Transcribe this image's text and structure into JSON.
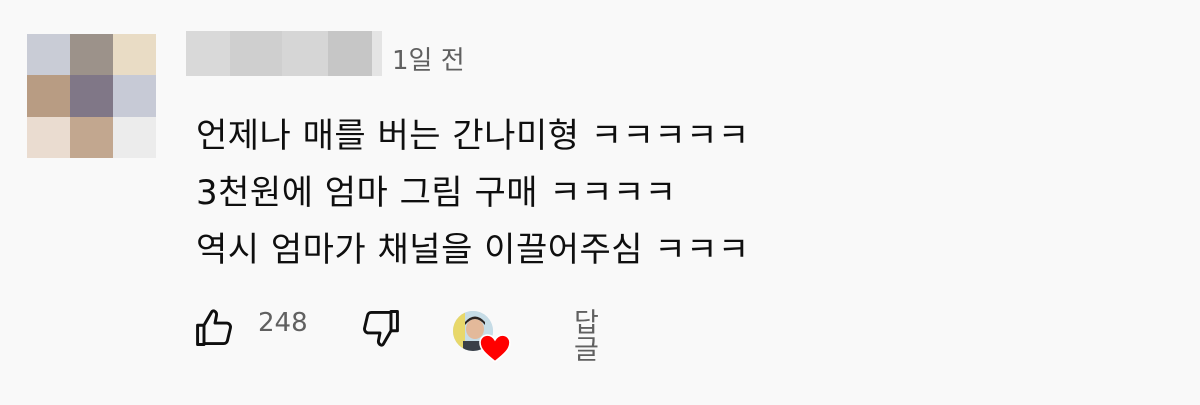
{
  "comment": {
    "timestamp": "1일 전",
    "lines": [
      "언제나 매를 버는 간나미형 ㅋㅋㅋㅋㅋ",
      "3천원에 엄마 그림 구매 ㅋㅋㅋㅋ",
      "역시 엄마가 채널을 이끌어주심 ㅋㅋㅋ"
    ]
  },
  "actions": {
    "like_count": "248",
    "reply_label": "답글"
  },
  "icons": {
    "like": "thumbs-up-icon",
    "dislike": "thumbs-down-icon",
    "creator_heart": "heart-icon"
  },
  "colors": {
    "background": "#f9f9f9",
    "text_primary": "#0f0f0f",
    "text_secondary": "#606060",
    "heart": "#ff0000"
  }
}
